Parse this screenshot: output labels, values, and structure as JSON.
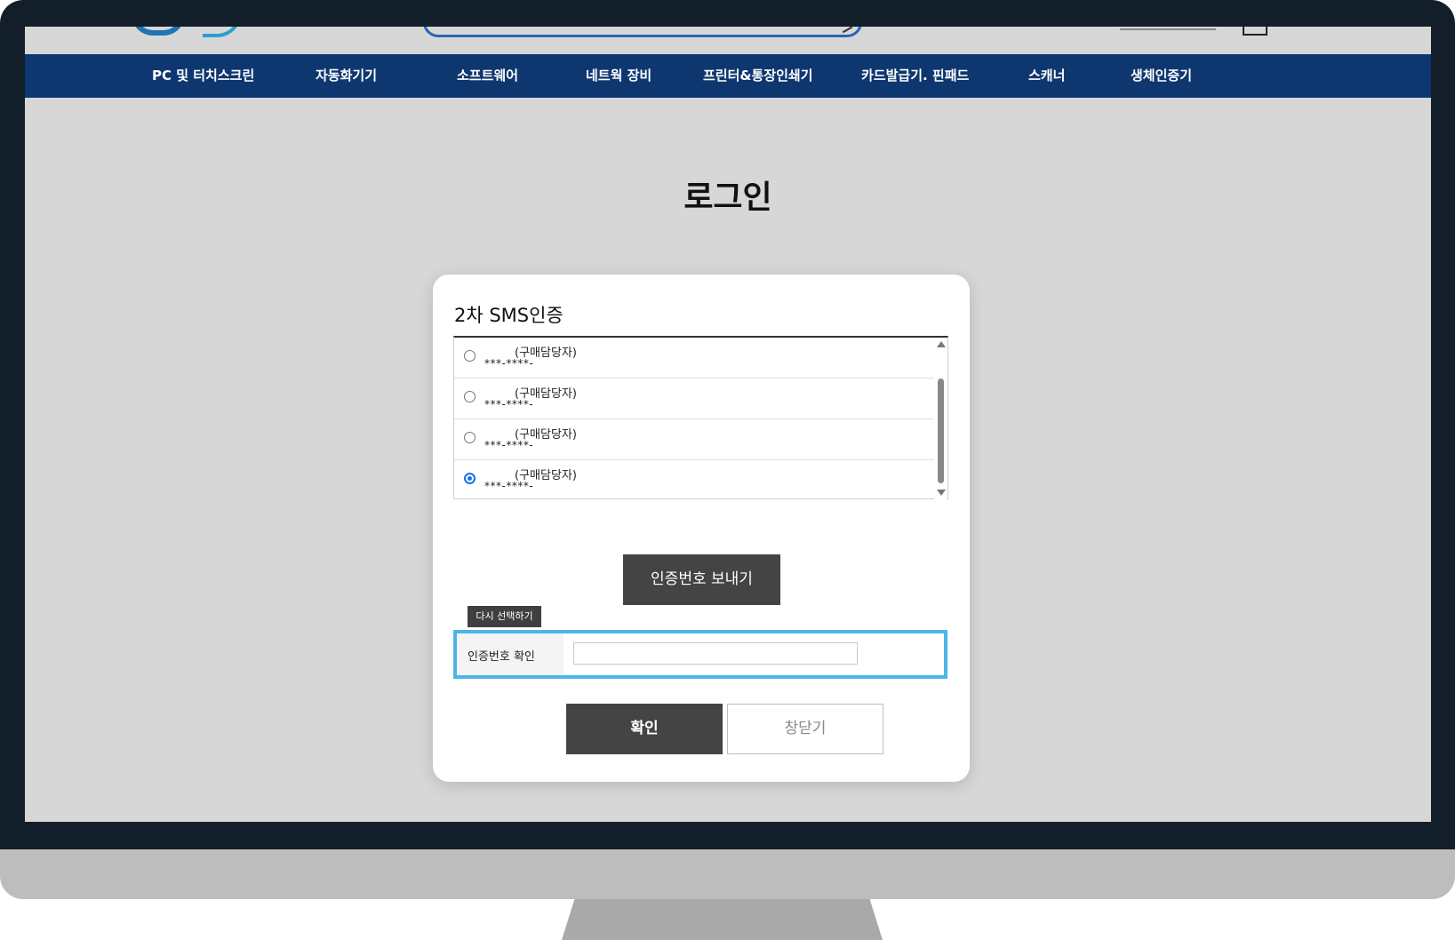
{
  "nav": {
    "items": [
      {
        "label": "PC 및 터치스크린"
      },
      {
        "label": "자동화기기"
      },
      {
        "label": "소프트웨어"
      },
      {
        "label": "네트웍 장비"
      },
      {
        "label": "프린터&통장인쇄기"
      },
      {
        "label": "카드발급기. 핀패드"
      },
      {
        "label": "스캐너"
      },
      {
        "label": "생체인증기"
      }
    ]
  },
  "page": {
    "title": "로그인"
  },
  "modal": {
    "title": "2차 SMS인증",
    "contacts": [
      {
        "role": "(구매담당자)",
        "phone": "***-****-",
        "selected": false
      },
      {
        "role": "(구매담당자)",
        "phone": "***-****-",
        "selected": false
      },
      {
        "role": "(구매담당자)",
        "phone": "***-****-",
        "selected": false
      },
      {
        "role": "(구매담당자)",
        "phone": "***-****-",
        "selected": true
      }
    ],
    "send_label": "인증번호 보내기",
    "reselect_label": "다시 선택하기",
    "verify_label": "인증번호 확인",
    "verify_value": "",
    "confirm_label": "확인",
    "close_label": "창닫기"
  },
  "colors": {
    "nav_bg": "#0e3770",
    "dark_button": "#444444",
    "highlight_border": "#4db5e8",
    "radio_selected": "#1a73e8"
  }
}
